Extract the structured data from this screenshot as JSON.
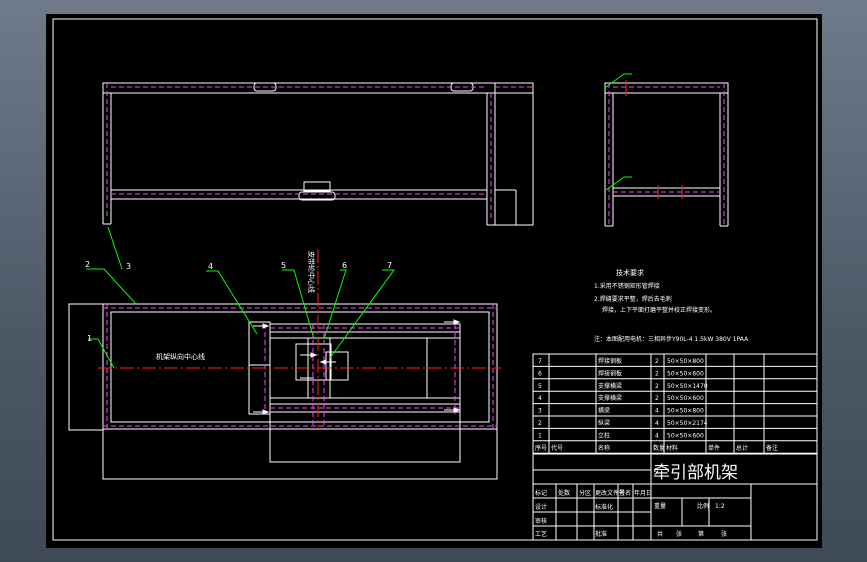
{
  "drawing": {
    "title": "牵引部机架",
    "tech_req_heading": "技术要求",
    "tech_req_1": "1.采用不锈钢矩形管焊接",
    "tech_req_2": "2.焊缝要求平整，焊后去毛刺",
    "tech_req_3": "焊接，上下平面打磨平整并校正焊接变形。",
    "note": "注：本图配用电机：三相异步Y90L-4 1.5kW 380V 1PAA",
    "vertical_label": "皮带轮中心线",
    "center_label": "机架纵向中心线",
    "callouts": [
      "1",
      "2",
      "3",
      "4",
      "5",
      "6",
      "7"
    ],
    "bom_rows": [
      {
        "no": "7",
        "name": "焊接钢板",
        "qty": "2",
        "spec": "50×50×800"
      },
      {
        "no": "6",
        "name": "焊接钢板",
        "qty": "2",
        "spec": "50×50×600"
      },
      {
        "no": "5",
        "name": "支撑横梁",
        "qty": "2",
        "spec": "50×50×1470"
      },
      {
        "no": "4",
        "name": "支撑横梁",
        "qty": "2",
        "spec": "50×50×600"
      },
      {
        "no": "3",
        "name": "横梁",
        "qty": "4",
        "spec": "50×50×800"
      },
      {
        "no": "2",
        "name": "纵梁",
        "qty": "4",
        "spec": "50×50×2174"
      },
      {
        "no": "1",
        "name": "立柱",
        "qty": "4",
        "spec": "50×50×600"
      }
    ],
    "bom_header": [
      "序号",
      "代号",
      "名称",
      "数量",
      "材料",
      "单件",
      "总计",
      "备注"
    ],
    "scale_label": "比例",
    "ratio_value": "1:2",
    "sheet_label": "共张",
    "tb_labels": [
      "标记",
      "处数",
      "分区",
      "更改文件号",
      "签名",
      "年月日"
    ],
    "tb_row_labels": [
      "设计",
      "审核",
      "工艺",
      "批准"
    ],
    "tb_mid_labels": [
      "标准化"
    ],
    "tb_bottom": [
      "共",
      "张",
      "第",
      "张"
    ],
    "tb_weight": "重量"
  },
  "colors": {
    "background": "#000000",
    "frame": "#ffffff",
    "hidden_line": "#ff40ff",
    "centerline": "#ff2020",
    "leader": "#00ff00"
  }
}
